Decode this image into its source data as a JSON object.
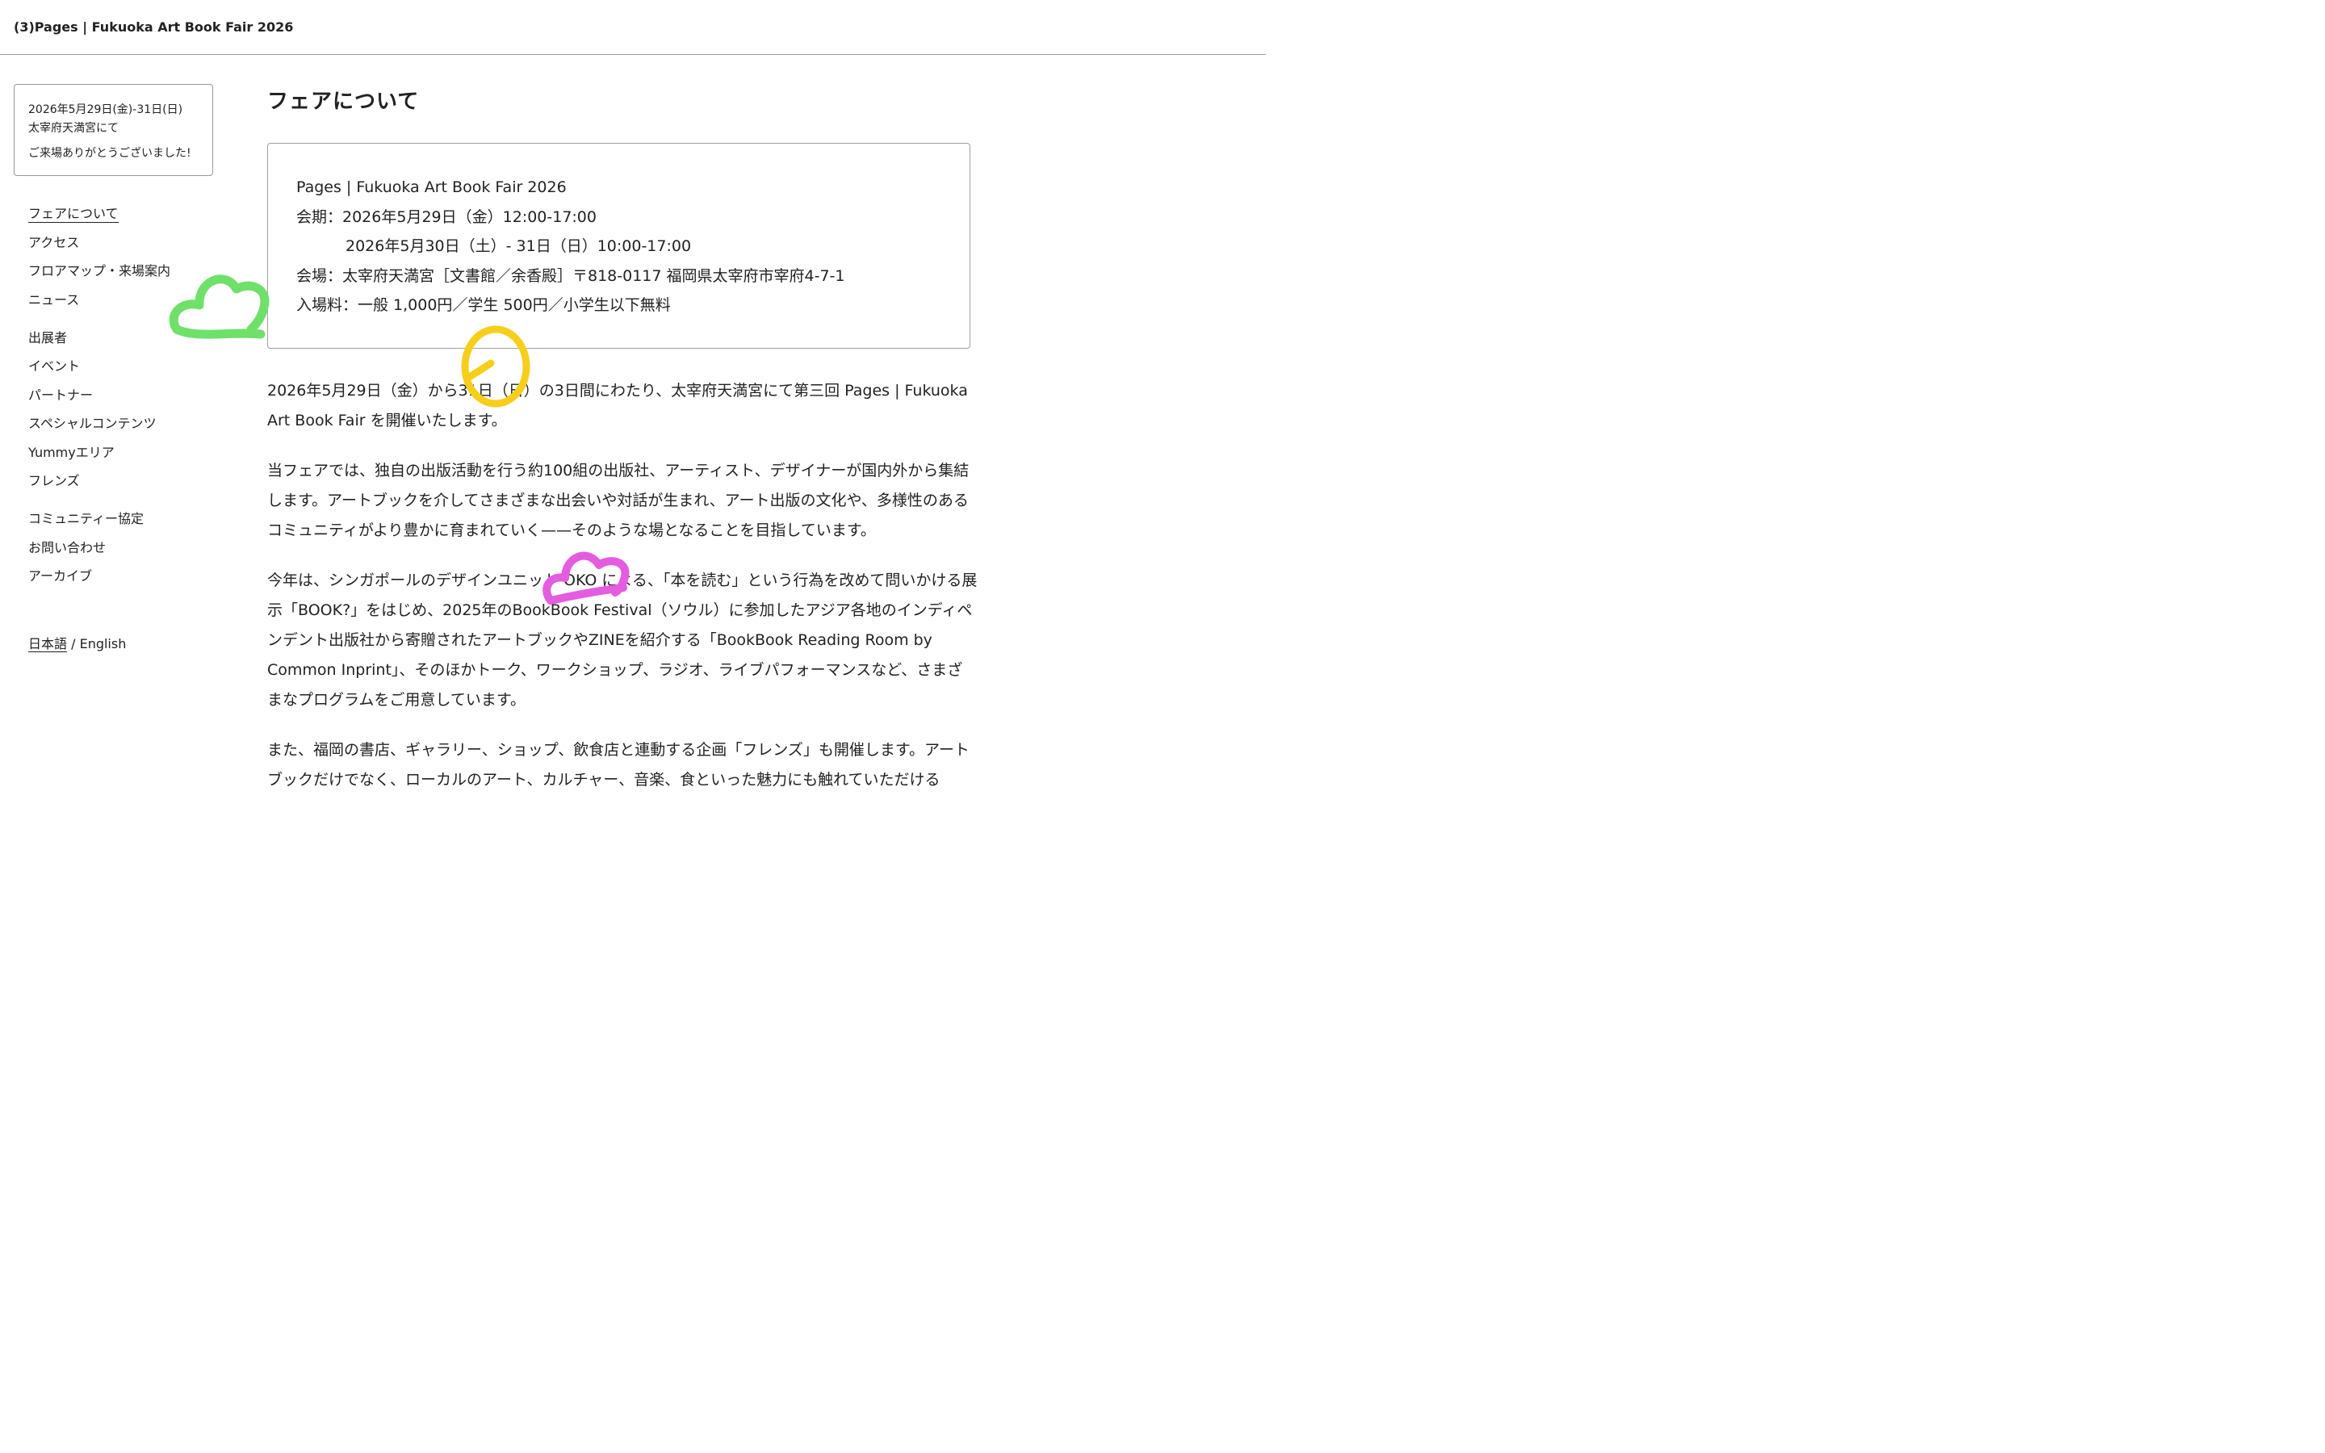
{
  "header": {
    "title": "(3)Pages | Fukuoka Art Book Fair 2026"
  },
  "info_box": {
    "dates": "2026年5月29日(金)-31日(日)",
    "venue": "太宰府天満宮にて",
    "thanks": "ご来場ありがとうございました!"
  },
  "nav": {
    "group1": [
      "フェアについて",
      "アクセス",
      "フロアマップ・来場案内",
      "ニュース"
    ],
    "group2": [
      "出展者",
      "イベント",
      "パートナー",
      "スペシャルコンテンツ",
      "Yummyエリア",
      "フレンズ"
    ],
    "group3": [
      "コミュニティー協定",
      "お問い合わせ",
      "アーカイブ"
    ],
    "active": "フェアについて"
  },
  "language": {
    "ja": "日本語",
    "separator": " / ",
    "en": "English"
  },
  "main": {
    "heading": "フェアについて",
    "details": {
      "event_name": "Pages | Fukuoka Art Book Fair 2026",
      "period_1": "会期：2026年5月29日（金）12:00-17:00",
      "period_2": "2026年5月30日（土）- 31日（日）10:00-17:00",
      "venue": "会場：太宰府天満宮［文書館／余香殿］〒818-0117 福岡県太宰府市宰府4-7-1",
      "admission": "入場料：一般 1,000円／学生 500円／小学生以下無料"
    },
    "paragraphs": [
      "2026年5月29日（金）から31日（日）の3日間にわたり、太宰府天満宮にて第三回 Pages | Fukuoka Art Book Fair を開催いたします。",
      "当フェアでは、独自の出版活動を行う約100組の出版社、アーティスト、デザイナーが国内外から集結します。アートブックを介してさまざまな出会いや対話が生まれ、アート出版の文化や、多様性のあるコミュニティがより豊かに育まれていく——そのような場となることを目指しています。",
      "今年は、シンガポールのデザインユニット  OKO による、「本を読む」という行為を改めて問いかける展示「BOOK?」をはじめ、2025年のBookBook Festival（ソウル）に参加したアジア各地のインディペンデント出版社から寄贈されたアートブックやZINEを紹介する「BookBook Reading Room by Common Inprint」、そのほかトーク、ワークショップ、ラジオ、ライブパフォーマンスなど、さまざまなプログラムをご用意しています。",
      "また、福岡の書店、ギャラリー、ショップ、飲食店と連動する企画「フレンズ」も開催します。アートブックだけでなく、ローカルのアート、カルチャー、音楽、食といった魅力にも触れていただける"
    ]
  },
  "doodles": {
    "green": "#6fe06a",
    "yellow": "#f7cf1a",
    "magenta": "#e45ce0"
  }
}
